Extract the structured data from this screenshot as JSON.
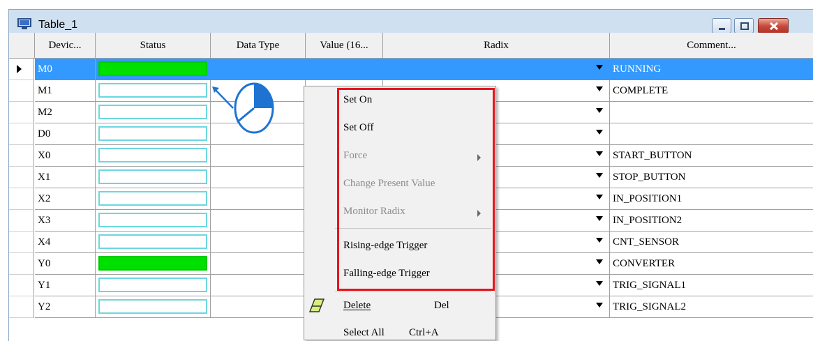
{
  "window": {
    "title": "Table_1"
  },
  "columns": [
    "Devic...",
    "Status",
    "Data Type",
    "Value (16...",
    "Radix",
    "Comment..."
  ],
  "rows": [
    {
      "device": "M0",
      "status_on": true,
      "comment": "RUNNING"
    },
    {
      "device": "M1",
      "status_on": false,
      "comment": "COMPLETE"
    },
    {
      "device": "M2",
      "status_on": false,
      "comment": ""
    },
    {
      "device": "D0",
      "status_on": false,
      "comment": ""
    },
    {
      "device": "X0",
      "status_on": false,
      "comment": "START_BUTTON"
    },
    {
      "device": "X1",
      "status_on": false,
      "comment": "STOP_BUTTON"
    },
    {
      "device": "X2",
      "status_on": false,
      "comment": "IN_POSITION1"
    },
    {
      "device": "X3",
      "status_on": false,
      "comment": "IN_POSITION2"
    },
    {
      "device": "X4",
      "status_on": false,
      "comment": "CNT_SENSOR"
    },
    {
      "device": "Y0",
      "status_on": true,
      "comment": "CONVERTER"
    },
    {
      "device": "Y1",
      "status_on": false,
      "comment": "TRIG_SIGNAL1"
    },
    {
      "device": "Y2",
      "status_on": false,
      "comment": "TRIG_SIGNAL2"
    }
  ],
  "context_menu": {
    "set_on": "Set On",
    "set_off": "Set Off",
    "force": "Force",
    "change_present_value": "Change Present Value",
    "monitor_radix": "Monitor Radix",
    "rising_edge": "Rising-edge Trigger",
    "falling_edge": "Falling-edge Trigger",
    "delete": "Delete",
    "delete_shortcut": "Del",
    "select_all": "Select All",
    "select_all_shortcut": "Ctrl+A"
  },
  "colors": {
    "selection": "#3399ff",
    "status_on": "#00e000",
    "highlight_box": "#e8141c"
  },
  "icons": {
    "app": "monitor-table-icon",
    "cursor": "mouse-cursor-icon",
    "click": "right-click-mouse-icon",
    "delete": "eraser-icon"
  }
}
